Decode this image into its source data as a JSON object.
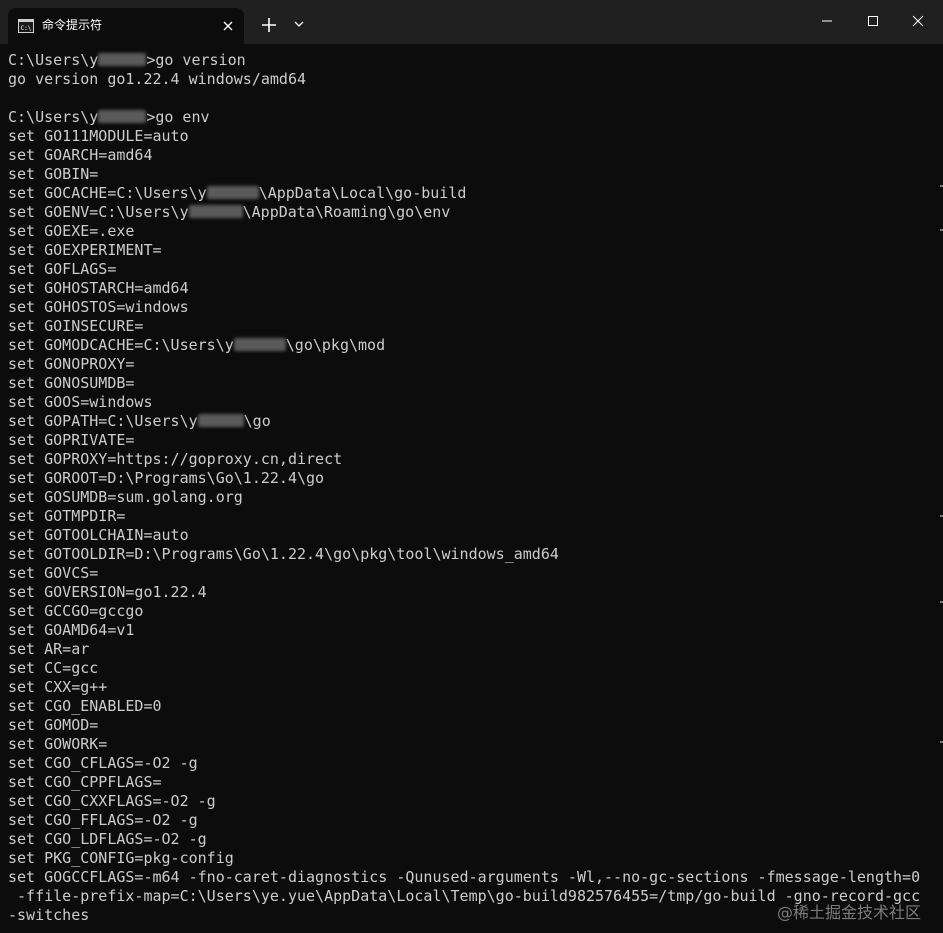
{
  "window": {
    "tab_title": "命令提示符",
    "tab_icon": "command-prompt-icon",
    "close_tab_icon": "close-icon",
    "new_tab_icon": "plus-icon",
    "dropdown_icon": "chevron-down-icon",
    "minimize_icon": "minimize-icon",
    "maximize_icon": "maximize-icon",
    "close_window_icon": "close-icon"
  },
  "terminal": {
    "lines": [
      {
        "before": "C:\\Users\\y",
        "after": ">go version"
      },
      {
        "text": "go version go1.22.4 windows/amd64"
      },
      {
        "text": ""
      },
      {
        "before": "C:\\Users\\y",
        "after": ">go env"
      },
      {
        "text": "set GO111MODULE=auto"
      },
      {
        "text": "set GOARCH=amd64"
      },
      {
        "text": "set GOBIN="
      },
      {
        "before": "set GOCACHE=C:\\Users\\y",
        "after": "\\AppData\\Local\\go-build"
      },
      {
        "before": "set GOENV=C:\\Users\\y",
        "after": "\\AppData\\Roaming\\go\\env"
      },
      {
        "text": "set GOEXE=.exe"
      },
      {
        "text": "set GOEXPERIMENT="
      },
      {
        "text": "set GOFLAGS="
      },
      {
        "text": "set GOHOSTARCH=amd64"
      },
      {
        "text": "set GOHOSTOS=windows"
      },
      {
        "text": "set GOINSECURE="
      },
      {
        "before": "set GOMODCACHE=C:\\Users\\y",
        "after": "\\go\\pkg\\mod"
      },
      {
        "text": "set GONOPROXY="
      },
      {
        "text": "set GONOSUMDB="
      },
      {
        "text": "set GOOS=windows"
      },
      {
        "before": "set GOPATH=C:\\Users\\y",
        "after": "\\go"
      },
      {
        "text": "set GOPRIVATE="
      },
      {
        "text": "set GOPROXY=https://goproxy.cn,direct"
      },
      {
        "text": "set GOROOT=D:\\Programs\\Go\\1.22.4\\go"
      },
      {
        "text": "set GOSUMDB=sum.golang.org"
      },
      {
        "text": "set GOTMPDIR="
      },
      {
        "text": "set GOTOOLCHAIN=auto"
      },
      {
        "text": "set GOTOOLDIR=D:\\Programs\\Go\\1.22.4\\go\\pkg\\tool\\windows_amd64"
      },
      {
        "text": "set GOVCS="
      },
      {
        "text": "set GOVERSION=go1.22.4"
      },
      {
        "text": "set GCCGO=gccgo"
      },
      {
        "text": "set GOAMD64=v1"
      },
      {
        "text": "set AR=ar"
      },
      {
        "text": "set CC=gcc"
      },
      {
        "text": "set CXX=g++"
      },
      {
        "text": "set CGO_ENABLED=0"
      },
      {
        "text": "set GOMOD="
      },
      {
        "text": "set GOWORK="
      },
      {
        "text": "set CGO_CFLAGS=-O2 -g"
      },
      {
        "text": "set CGO_CPPFLAGS="
      },
      {
        "text": "set CGO_CXXFLAGS=-O2 -g"
      },
      {
        "text": "set CGO_FFLAGS=-O2 -g"
      },
      {
        "text": "set CGO_LDFLAGS=-O2 -g"
      },
      {
        "text": "set PKG_CONFIG=pkg-config"
      },
      {
        "text": "set GOGCCFLAGS=-m64 -fno-caret-diagnostics -Qunused-arguments -Wl,--no-gc-sections -fmessage-length=0"
      },
      {
        "text": " -ffile-prefix-map=C:\\Users\\ye.yue\\AppData\\Local\\Temp\\go-build982576455=/tmp/go-build -gno-record-gcc"
      },
      {
        "text": "-switches"
      }
    ]
  },
  "watermark": "@稀土掘金技术社区"
}
